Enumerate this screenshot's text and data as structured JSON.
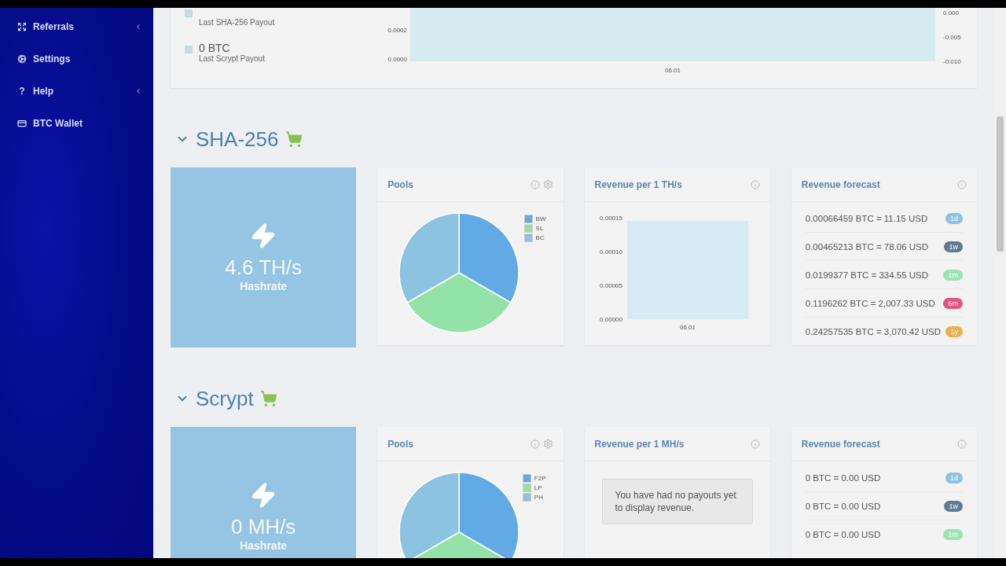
{
  "sidebar": {
    "items": [
      {
        "label": "Referrals",
        "has_submenu": true
      },
      {
        "label": "Settings",
        "has_submenu": false
      },
      {
        "glyph": "?",
        "label": "Help",
        "has_submenu": true
      },
      {
        "label": "BTC Wallet",
        "has_submenu": false
      }
    ]
  },
  "payouts_card": {
    "rows": [
      {
        "label": "Last SHA-256 Payout"
      },
      {
        "value": "0 BTC",
        "label": "Last Scrypt Payout"
      }
    ],
    "chart": {
      "left_axis_labels": [
        "0.0002",
        "0.0000"
      ],
      "right_axis_labels": [
        "0.000",
        "-0.005",
        "-0.010"
      ],
      "x_label": "06.01"
    }
  },
  "sections": [
    {
      "title": "SHA-256",
      "hashrate": {
        "value": "4.6 TH/s",
        "label": "Hashrate"
      },
      "pools": {
        "title": "Pools",
        "legend": [
          {
            "label": "BW",
            "color": "#62aae6"
          },
          {
            "label": "SL",
            "color": "#93e2a8"
          },
          {
            "label": "BC",
            "color": "#8cc3e0"
          }
        ]
      },
      "revenue": {
        "title": "Revenue per 1 TH/s",
        "chart": {
          "axis_labels": [
            "0.00015",
            "0.00010",
            "0.00005",
            "0.00000"
          ],
          "x_label": "06.01"
        }
      },
      "forecast": {
        "title": "Revenue forecast",
        "rows": [
          {
            "text": "0.00066459 BTC = 11.15 USD",
            "badge": "1d",
            "color": "#8ec3e0"
          },
          {
            "text": "0.00465213 BTC = 78.06 USD",
            "badge": "1w",
            "color": "#5f7b96"
          },
          {
            "text": "0.0199377 BTC = 334.55 USD",
            "badge": "1m",
            "color": "#9ee3b2"
          },
          {
            "text": "0.1196262 BTC = 2,007.33 USD",
            "badge": "6m",
            "color": "#e0547e"
          },
          {
            "text": "0.24257535 BTC = 3,070.42 USD",
            "badge": "1y",
            "color": "#eeb04e"
          }
        ]
      }
    },
    {
      "title": "Scrypt",
      "hashrate": {
        "value": "0 MH/s",
        "label": "Hashrate"
      },
      "pools": {
        "title": "Pools",
        "legend": [
          {
            "label": "F2P",
            "color": "#62aae6"
          },
          {
            "label": "LP",
            "color": "#93e2a8"
          },
          {
            "label": "PH",
            "color": "#8cc3e0"
          }
        ]
      },
      "revenue": {
        "title": "Revenue per 1 MH/s",
        "message": "You have had no payouts yet to display revenue."
      },
      "forecast": {
        "title": "Revenue forecast",
        "rows": [
          {
            "text": "0 BTC = 0.00 USD",
            "badge": "1d",
            "color": "#8ec3e0"
          },
          {
            "text": "0 BTC = 0.00 USD",
            "badge": "1w",
            "color": "#5f7b96"
          },
          {
            "text": "0 BTC = 0.00 USD",
            "badge": "1m",
            "color": "#9ee3b2"
          }
        ]
      }
    }
  ]
}
